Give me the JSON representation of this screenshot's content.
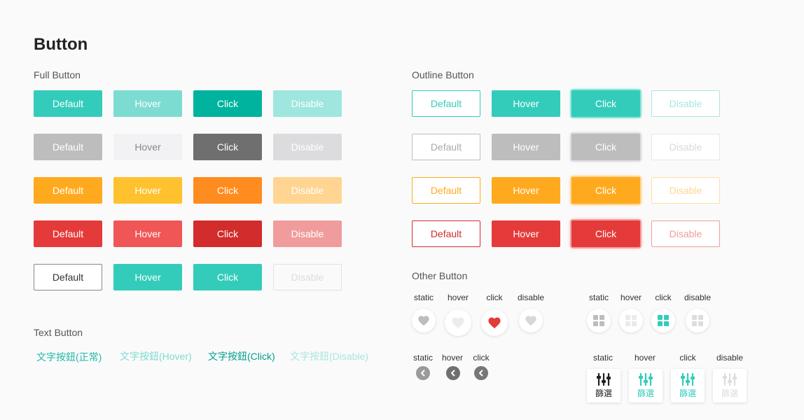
{
  "page_title": "Button",
  "full": {
    "heading": "Full Button",
    "rows": [
      [
        "Default",
        "Hover",
        "Click",
        "Disable"
      ],
      [
        "Default",
        "Hover",
        "Click",
        "Disable"
      ],
      [
        "Default",
        "Hover",
        "Click",
        "Disable"
      ],
      [
        "Default",
        "Hover",
        "Click",
        "Disable"
      ],
      [
        "Default",
        "Hover",
        "Click",
        "Disable"
      ]
    ]
  },
  "outline": {
    "heading": "Outline Button",
    "rows": [
      [
        "Default",
        "Hover",
        "Click",
        "Disable"
      ],
      [
        "Default",
        "Hover",
        "Click",
        "Disable"
      ],
      [
        "Default",
        "Hover",
        "Click",
        "Disable"
      ],
      [
        "Default",
        "Hover",
        "Click",
        "Disable"
      ]
    ]
  },
  "text_buttons": {
    "heading": "Text Button",
    "items": [
      "文字按鈕(正常)",
      "文字按鈕(Hover)",
      "文字按鈕(Click)",
      "文字按鈕(Disable)"
    ]
  },
  "other": {
    "heading": "Other Button",
    "heart_labels": [
      "static",
      "hover",
      "click",
      "disable"
    ],
    "grid_labels": [
      "static",
      "hover",
      "click",
      "disable"
    ],
    "arrow_labels": [
      "static",
      "hover",
      "click"
    ],
    "filter_labels": [
      "static",
      "hover",
      "click",
      "disable"
    ],
    "filter_text": "篩選"
  },
  "colors": {
    "teal": "#33ccbb",
    "gray": "#bdbdbd",
    "orange": "#ffaa1e",
    "red": "#e53a3a"
  }
}
